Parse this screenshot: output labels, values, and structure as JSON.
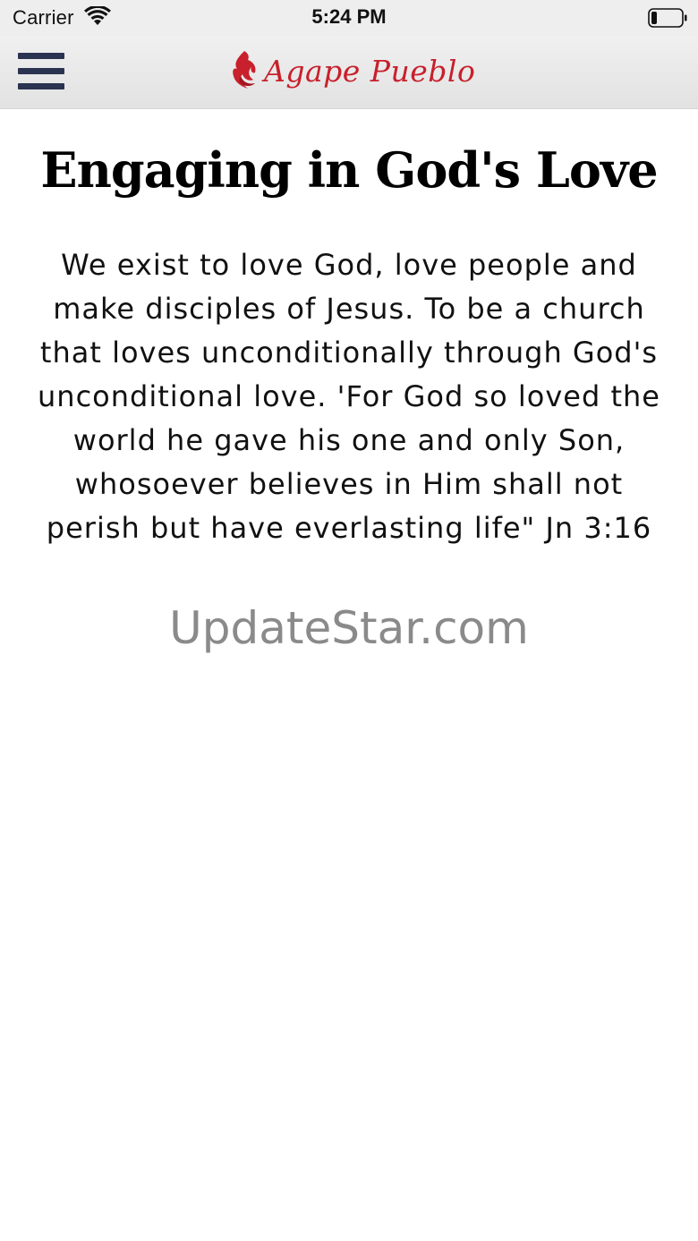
{
  "status_bar": {
    "carrier": "Carrier",
    "time": "5:24 PM",
    "wifi_icon": "wifi-icon",
    "battery_icon": "battery-icon"
  },
  "header": {
    "menu_icon": "hamburger-menu-icon",
    "logo_icon": "flame-icon",
    "brand_name": "Agape Pueblo",
    "brand_color": "#c8202c",
    "menu_color": "#2a3350"
  },
  "main": {
    "title": "Engaging in God's Love",
    "body": "We exist to love God, love people and make disciples of Jesus. To be a church that loves unconditionally through God's unconditional love. 'For God so loved the world he gave his one and only Son, whosoever believes in Him shall not perish but have everlasting life\" Jn 3:16",
    "watermark": "UpdateStar.com"
  }
}
